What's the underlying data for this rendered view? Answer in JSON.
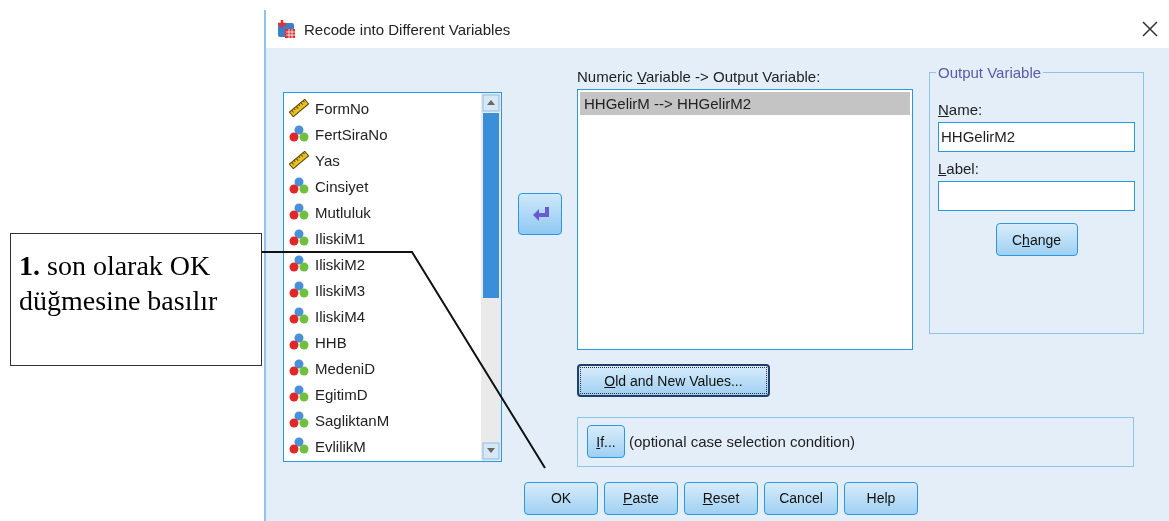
{
  "callout": {
    "text": "**1.** son olarak OK düğmesine basılır"
  },
  "window": {
    "title": "Recode into Different Variables"
  },
  "source_variables": [
    {
      "name": "FormNo",
      "kind": "scale"
    },
    {
      "name": "FertSiraNo",
      "kind": "nominal"
    },
    {
      "name": "Yas",
      "kind": "scale"
    },
    {
      "name": "Cinsiyet",
      "kind": "nominal"
    },
    {
      "name": "Mutluluk",
      "kind": "nominal"
    },
    {
      "name": "IliskiM1",
      "kind": "nominal"
    },
    {
      "name": "IliskiM2",
      "kind": "nominal"
    },
    {
      "name": "IliskiM3",
      "kind": "nominal"
    },
    {
      "name": "IliskiM4",
      "kind": "nominal"
    },
    {
      "name": "HHB",
      "kind": "nominal"
    },
    {
      "name": "MedeniD",
      "kind": "nominal"
    },
    {
      "name": "EgitimD",
      "kind": "nominal"
    },
    {
      "name": "SagliktanM",
      "kind": "nominal"
    },
    {
      "name": "EvlilikM",
      "kind": "nominal"
    }
  ],
  "target_list": {
    "label": {
      "pre": "Numeric ",
      "key": "V",
      "post": "ariable -> Output Variable:"
    },
    "items": [
      {
        "text": "HHGelirM --> HHGelirM2",
        "selected": true
      }
    ]
  },
  "output_variable": {
    "title": "Output Variable",
    "name_label": {
      "key": "N",
      "post": "ame:"
    },
    "name_value": "HHGelirM2",
    "label_label": {
      "key": "L",
      "post": "abel:"
    },
    "change_button": {
      "label": {
        "pre": "C",
        "key": "h",
        "post": "ange"
      },
      "focused": false
    }
  },
  "old_new_button": {
    "label": {
      "key": "O",
      "post": "ld and New Values..."
    },
    "focused": true
  },
  "if_panel": {
    "button": {
      "label": {
        "key": "I",
        "post": "f..."
      },
      "focused": false
    },
    "text": "(optional case selection condition)"
  },
  "buttons": [
    {
      "label": {
        "pre": "OK"
      },
      "focused": false
    },
    {
      "label": {
        "key": "P",
        "post": "aste"
      },
      "focused": false
    },
    {
      "label": {
        "key": "R",
        "post": "eset"
      },
      "focused": false
    },
    {
      "label": {
        "pre": "Cancel"
      },
      "focused": false
    },
    {
      "label": {
        "pre": "Help"
      },
      "focused": false
    }
  ]
}
